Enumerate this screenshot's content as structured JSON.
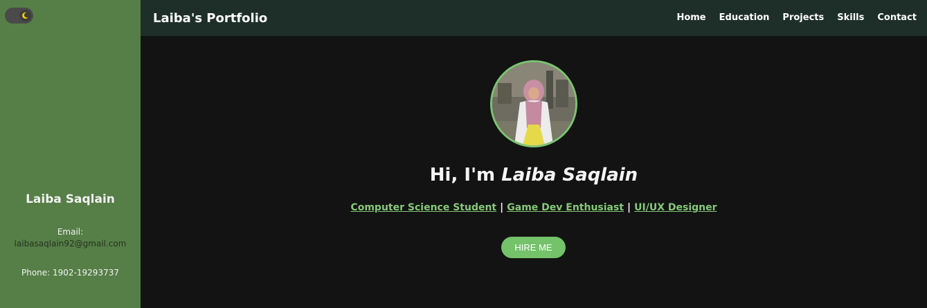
{
  "sidebar": {
    "name": "Laiba Saqlain",
    "email_label": "Email:",
    "email": "laibasaqlain92@gmail.com",
    "phone": "Phone: 1902-19293737",
    "theme_toggle_icon": "moon-icon"
  },
  "navbar": {
    "brand": "Laiba's Portfolio",
    "links": [
      "Home",
      "Education",
      "Projects",
      "Skills",
      "Contact"
    ]
  },
  "hero": {
    "greeting": "Hi, I'm ",
    "name": "Laiba Saqlain",
    "roles": [
      "Computer Science Student",
      "Game Dev Enthusiast",
      "UI/UX Designer"
    ],
    "separator": "|",
    "cta": "HIRE ME"
  },
  "colors": {
    "sidebar_bg": "#567f47",
    "navbar_bg": "#1e2f29",
    "page_bg": "#131313",
    "accent": "#74c26a"
  }
}
